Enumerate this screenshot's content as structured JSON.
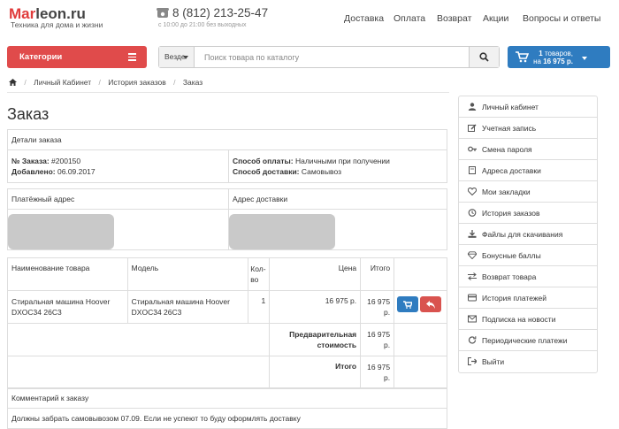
{
  "header": {
    "logo_accent": "Mar",
    "logo_rest": "leon.ru",
    "tagline": "Техника для дома и жизни",
    "phone": "8 (812) 213-25-47",
    "hours": "с 10:00 до 21:00 без выходных",
    "nav": [
      "Доставка",
      "Оплата",
      "Возврат",
      "Акции",
      "Вопросы и ответы"
    ]
  },
  "toolbar": {
    "categories_label": "Категории",
    "scope_label": "Везде",
    "search_placeholder": "Поиск товара по каталогу",
    "cart_line1_count": "1",
    "cart_line1_text": "товаров,",
    "cart_line2_prefix": "на",
    "cart_line2_total": "16 975 р."
  },
  "breadcrumb": [
    "Личный Кабинет",
    "История заказов",
    "Заказ"
  ],
  "page_title": "Заказ",
  "order_details": {
    "heading": "Детали заказа",
    "order_no_label": "№ Заказа:",
    "order_no": "#200150",
    "added_label": "Добавлено:",
    "added": "06.09.2017",
    "payment_label": "Способ оплаты:",
    "payment": "Наличными при получении",
    "shipping_label": "Способ доставки:",
    "shipping": "Самовывоз"
  },
  "addresses": {
    "payment_heading": "Платёжный адрес",
    "shipping_heading": "Адрес доставки"
  },
  "products": {
    "headers": {
      "name": "Наименование товара",
      "model": "Модель",
      "qty_1": "Кол-",
      "qty_2": "во",
      "price": "Цена",
      "total": "Итого"
    },
    "row": {
      "name": "Стиральная машина Hoover DXOC34 26C3",
      "model": "Стиральная машина Hoover DXOC34 26C3",
      "qty": "1",
      "price": "16 975 р.",
      "total": "16 975 р."
    },
    "subtotal_label": "Предварительная стоимость",
    "subtotal": "16 975 р.",
    "grand_label": "Итого",
    "grand": "16 975 р."
  },
  "comment": {
    "heading": "Комментарий к заказу",
    "text": "Должны забрать самовывозом 07.09. Если не успеют то буду оформлять доставку"
  },
  "sidebar": [
    {
      "label": "Личный кабинет",
      "icon": "user-icon"
    },
    {
      "label": "Учетная запись",
      "icon": "edit-icon"
    },
    {
      "label": "Смена пароля",
      "icon": "key-icon"
    },
    {
      "label": "Адреса доставки",
      "icon": "book-icon"
    },
    {
      "label": "Мои закладки",
      "icon": "heart-icon"
    },
    {
      "label": "История заказов",
      "icon": "history-icon"
    },
    {
      "label": "Файлы для скачивания",
      "icon": "download-icon"
    },
    {
      "label": "Бонусные баллы",
      "icon": "diamond-icon"
    },
    {
      "label": "Возврат товара",
      "icon": "exchange-icon"
    },
    {
      "label": "История платежей",
      "icon": "card-icon"
    },
    {
      "label": "Подписка на новости",
      "icon": "envelope-icon"
    },
    {
      "label": "Периодические платежи",
      "icon": "refresh-icon"
    },
    {
      "label": "Выйти",
      "icon": "signout-icon"
    }
  ],
  "colors": {
    "accent_red": "#e04b4b",
    "accent_blue": "#2f7cc0"
  }
}
